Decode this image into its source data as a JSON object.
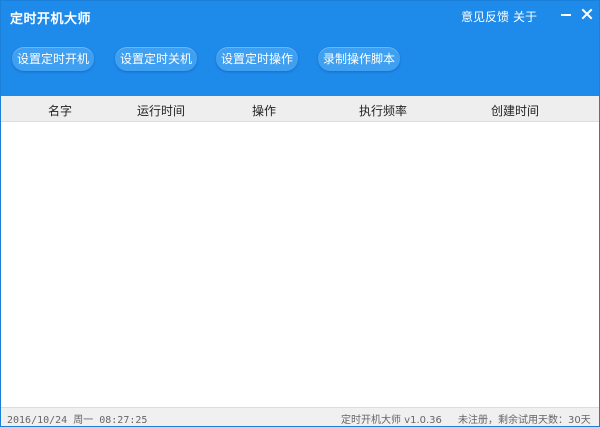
{
  "window": {
    "title": "定时开机大师"
  },
  "header_links": {
    "feedback": "意见反馈",
    "about": "关于"
  },
  "toolbar": {
    "set_boot": "设置定时开机",
    "set_shutdown": "设置定时关机",
    "set_operation": "设置定时操作",
    "record_script": "录制操作脚本"
  },
  "table": {
    "columns": [
      "名字",
      "运行时间",
      "操作",
      "执行频率",
      "创建时间"
    ],
    "rows": []
  },
  "status": {
    "datetime": "2016/10/24 周一 08:27:25",
    "version": "定时开机大师 v1.0.36",
    "registration": "未注册，剩余试用天数：30天"
  },
  "colors": {
    "header_bg": "#1e8aea",
    "button_bg": "#3f9ff0",
    "table_header_bg": "#eeeeee"
  }
}
